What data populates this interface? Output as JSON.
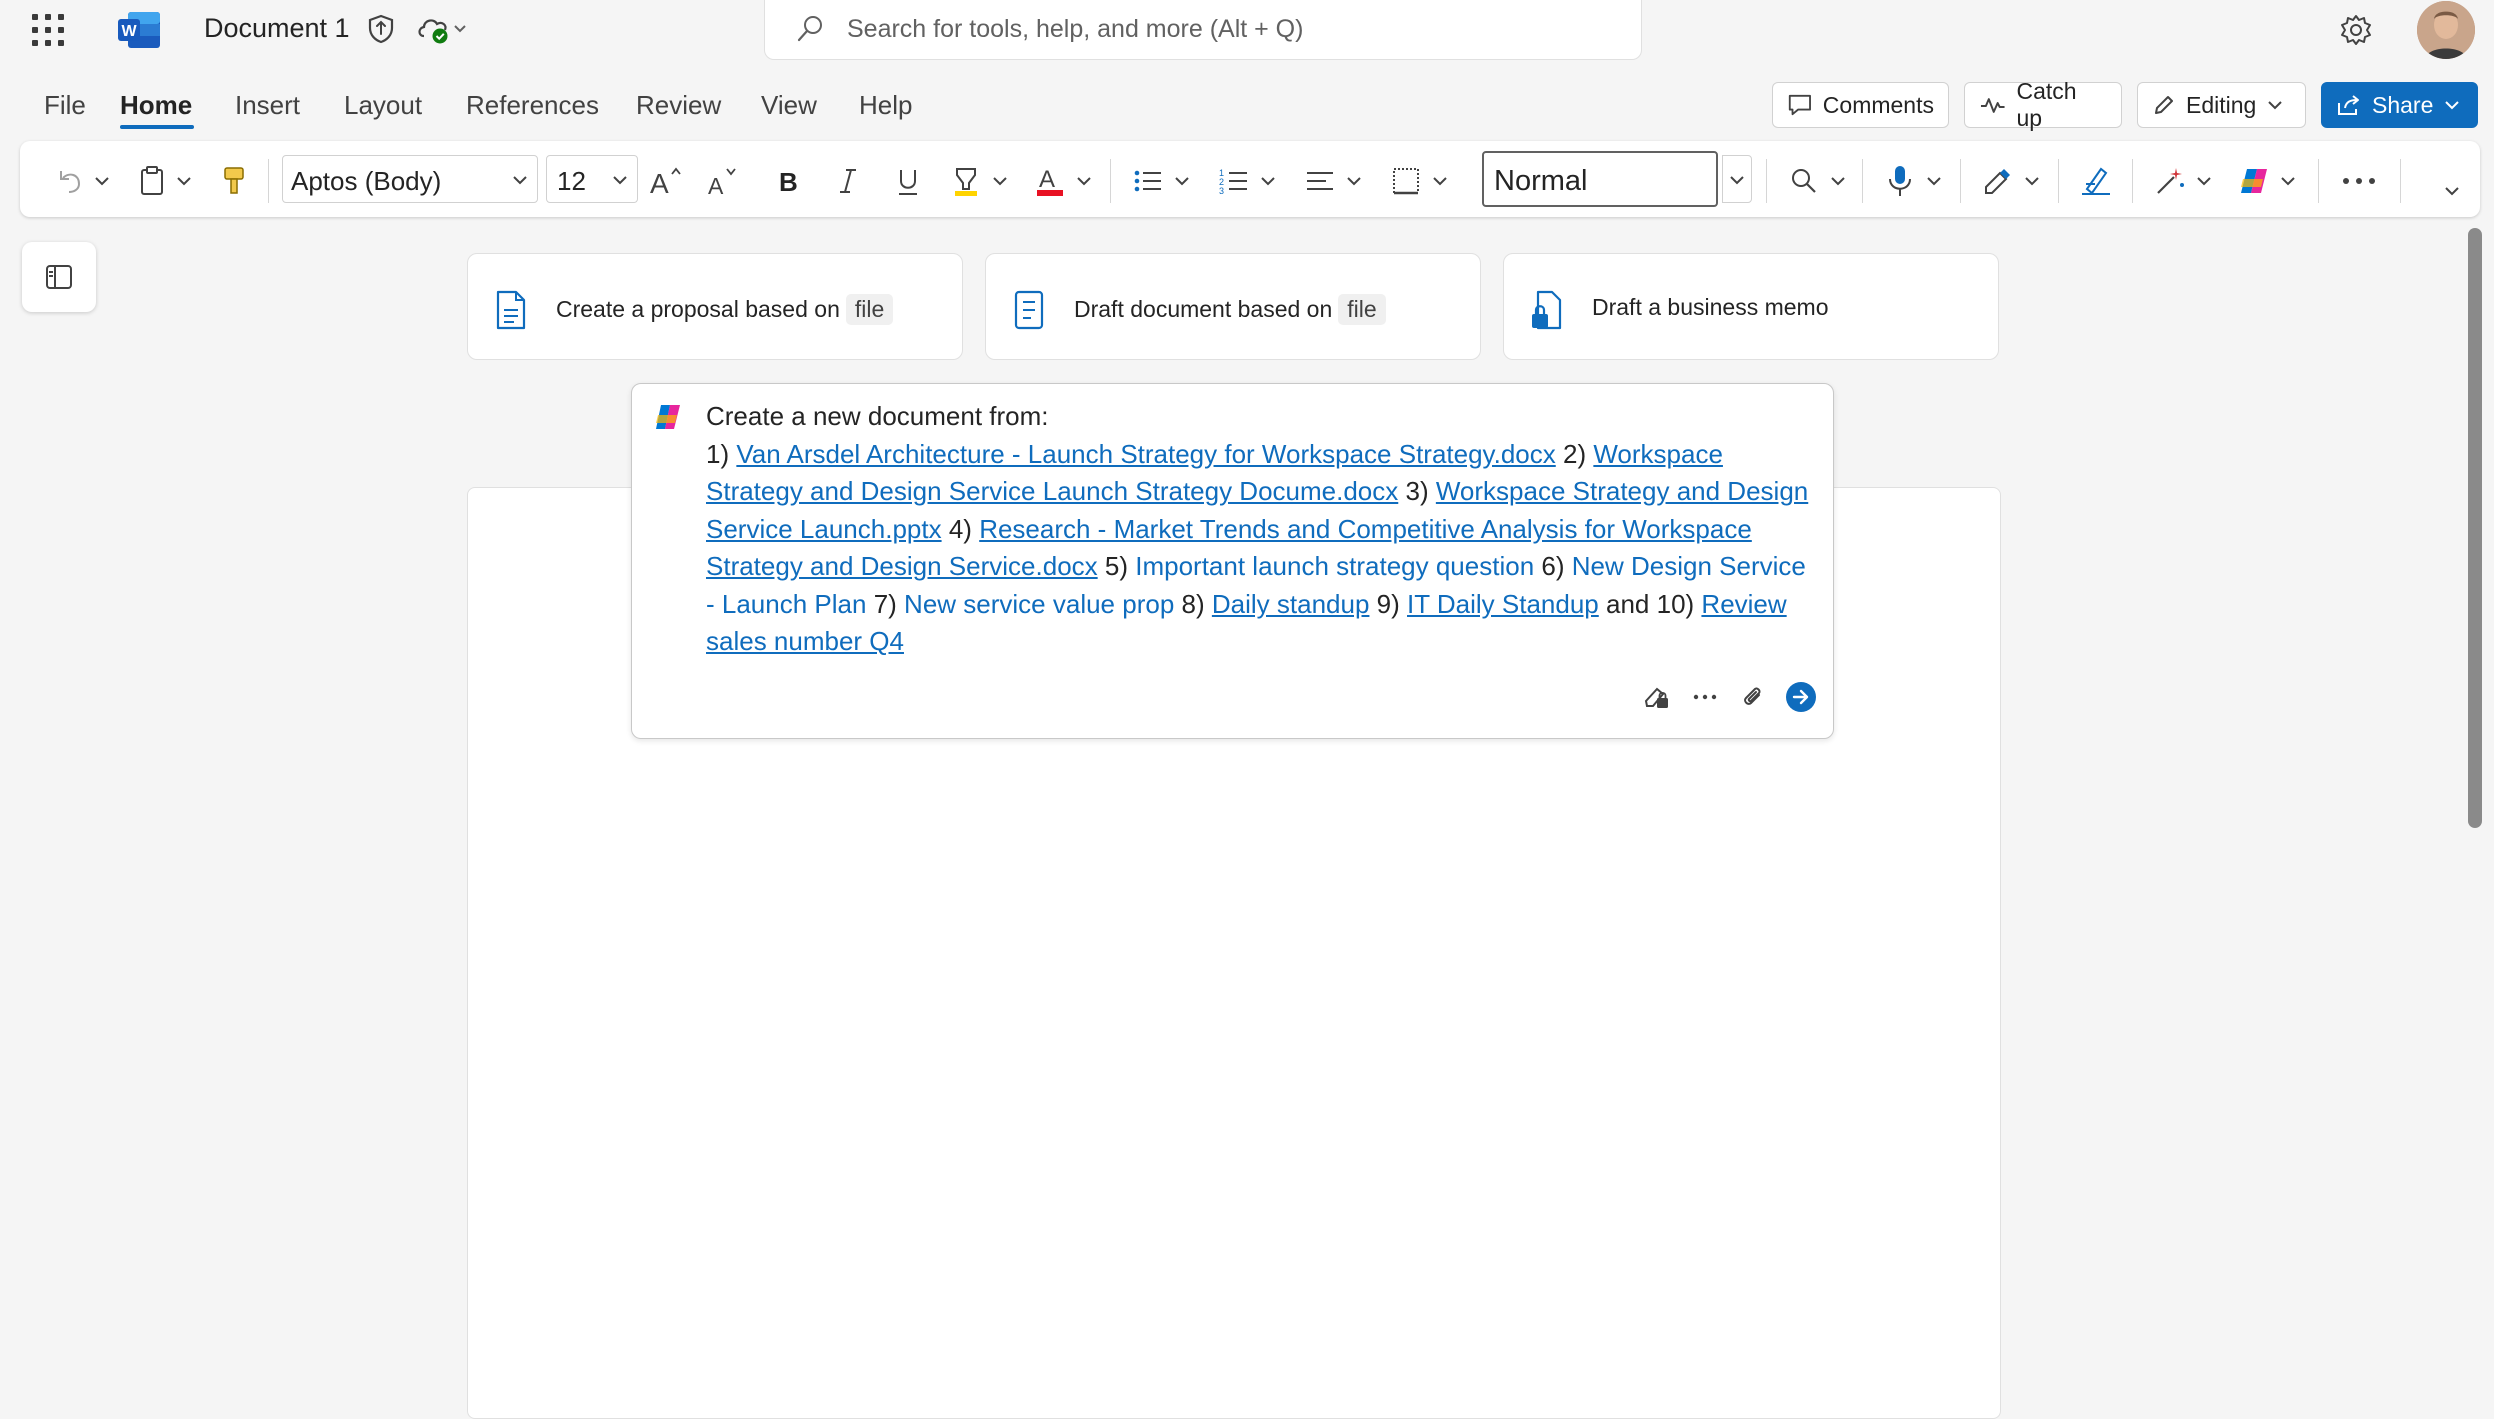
{
  "app": {
    "document_title": "Document 1",
    "search_placeholder": "Search for tools, help, and more (Alt + Q)"
  },
  "menu": {
    "tabs": [
      "File",
      "Home",
      "Insert",
      "Layout",
      "References",
      "Review",
      "View",
      "Help"
    ],
    "active_tab": "Home"
  },
  "actions": {
    "comments": "Comments",
    "catch_up": "Catch up",
    "editing": "Editing",
    "share": "Share"
  },
  "ribbon": {
    "font_name": "Aptos (Body)",
    "font_size": "12",
    "style": "Normal",
    "font_color": "#e81123",
    "highlight_color": "#ffd400"
  },
  "suggestions": [
    {
      "text": "Create a proposal based on",
      "chip": "file",
      "icon": "document-lines-icon"
    },
    {
      "text": "Draft document based on",
      "chip": "file",
      "icon": "document-text-icon"
    },
    {
      "text": "Draft a business memo",
      "chip": "",
      "icon": "document-lock-icon"
    }
  ],
  "prompt": {
    "intro": "Create a new document from:",
    "items": [
      {
        "n": "1)",
        "label": "Van Arsdel Architecture - Launch Strategy for Workspace Strategy.docx",
        "kind": "file"
      },
      {
        "n": "2)",
        "label": "Workspace Strategy and Design Service Launch Strategy Docume.docx",
        "kind": "file"
      },
      {
        "n": "3)",
        "label": "Workspace Strategy and Design Service Launch.pptx",
        "kind": "file"
      },
      {
        "n": "4)",
        "label": "Research - Market Trends and Competitive Analysis for Workspace Strategy and Design Service.docx",
        "kind": "file"
      },
      {
        "n": "5)",
        "label": "Important launch strategy question",
        "kind": "message"
      },
      {
        "n": "6)",
        "label": "New Design Service - Launch Plan",
        "kind": "message"
      },
      {
        "n": "7)",
        "label": "New service value prop",
        "kind": "message"
      },
      {
        "n": "8)",
        "label": "Daily standup",
        "kind": "meeting"
      },
      {
        "n": "9)",
        "label": "IT Daily Standup",
        "kind": "meeting"
      },
      {
        "n": "and 10)",
        "label": "Review sales number Q4",
        "kind": "meeting"
      }
    ]
  },
  "colors": {
    "accent": "#0f6cbd",
    "link": "#0f6cbd"
  }
}
